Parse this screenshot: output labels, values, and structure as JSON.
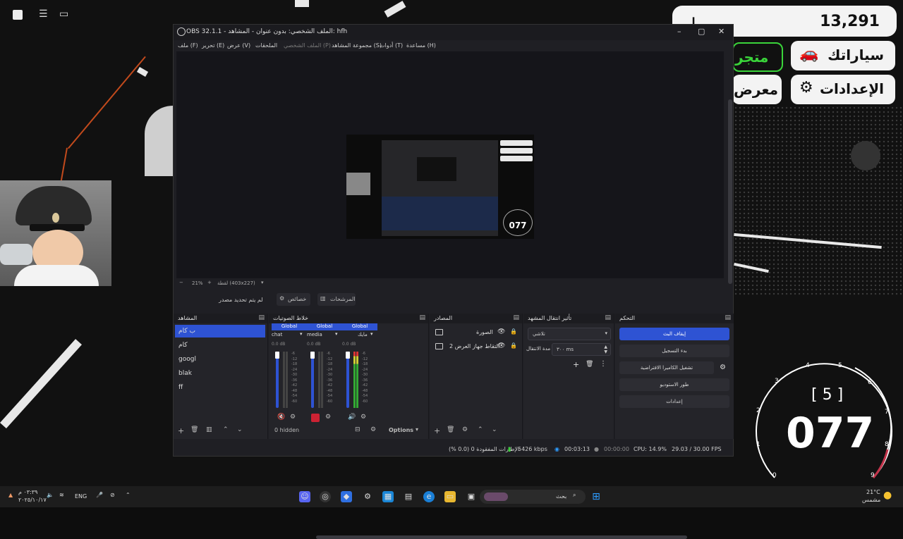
{
  "game_hud": {
    "money": "13,291",
    "currency_glyph": "⏚",
    "btn_cars": "سياراتك",
    "btn_settings": "الإعدادات",
    "btn_store_partial": "متجر",
    "btn_showroom_partial": "معرض",
    "speed": "077",
    "gear": "[ 5 ]",
    "speedo_ticks": [
      "0",
      "1",
      "2",
      "3",
      "4",
      "5",
      "6",
      "7",
      "8",
      "9"
    ]
  },
  "obs": {
    "title": "OBS 32.1.1 - الملف الشخصي: بدون عنوان - المشاهد: hfh",
    "menu": [
      "ملف (F)",
      "تحرير (E)",
      "عرض (V)",
      "الملحقات",
      "الملف الشخصي (P)",
      "مجموعة المشاهد (S)",
      "أدوات (T)",
      "مساعدة (H)"
    ],
    "preview_speed": "077",
    "zoom": "21%",
    "canvas_label": "لقطة (403x227)",
    "no_source_selected": "لم يتم تحديد مصدر",
    "tab_properties": "خصائص",
    "tab_filters": "المرشحات",
    "docks": {
      "scenes": "المشاهد",
      "mixer": "خلاط الصوتيات",
      "sources": "المصادر",
      "transitions": "تأثير انتقال المشهد",
      "controls": "التحكم"
    },
    "scenes": [
      "ب كام",
      "كام",
      "googl",
      "blak",
      "ff"
    ],
    "mixer": {
      "channels": [
        {
          "name": "chat",
          "global": "Global",
          "db": "0.0 dB"
        },
        {
          "name": "media",
          "global": "Global",
          "db": "0.0 dB"
        },
        {
          "name": "مايك",
          "global": "Global",
          "db": "0.0 dB"
        }
      ],
      "scale": [
        "-6",
        "-12",
        "-18",
        "-24",
        "-30",
        "-36",
        "-42",
        "-48",
        "-54",
        "-60"
      ],
      "hidden_label": "0 hidden",
      "options_label": "Options"
    },
    "sources": [
      "الصورة",
      "التقاط جهاز العرض 2"
    ],
    "transitions": {
      "type": "تلاشي",
      "duration_label": "مدة الانتقال",
      "duration_value": "٣٠٠ ms"
    },
    "controls": [
      "إيقاف البث",
      "بدء التسجيل",
      "تشغيل الكاميرا الافتراضية",
      "طور الاستوديو",
      "إعدادات"
    ],
    "status": {
      "dropped": "الإطارات المفقودة 0 (0.0 %)",
      "bitrate": "5426 kbps",
      "stream_time": "00:03:13",
      "rec_time": "00:00:00",
      "cpu": "CPU: 14.9%",
      "fps": "29.03 / 30.00 FPS"
    }
  },
  "taskbar": {
    "time": "٠٣:٣٩ م",
    "date": "٢٠٢٥/١٠/١٧",
    "lang": "ENG",
    "search_placeholder": "بحث",
    "weather_temp": "21°C",
    "weather_desc": "مشمس"
  },
  "colors": {
    "accent": "#2e53d3",
    "green": "#3ad43a",
    "hud_bg": "#f3f3f3"
  }
}
